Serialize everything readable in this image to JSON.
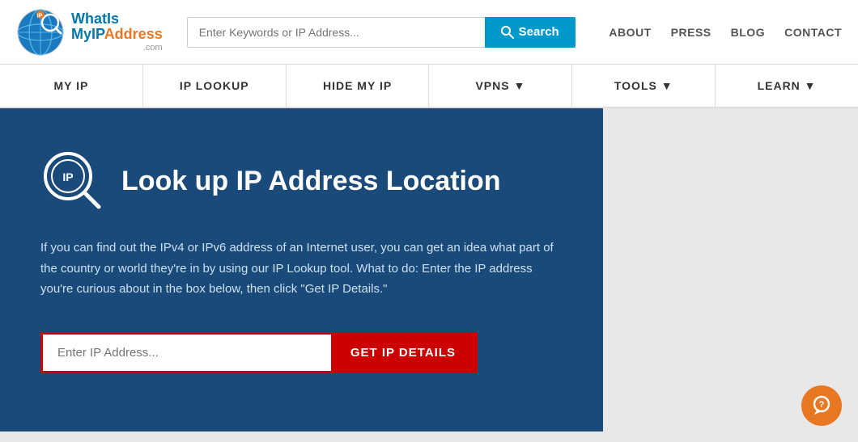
{
  "header": {
    "logo": {
      "whatis": "WhatIs",
      "myip": "MyIP",
      "address": "Address",
      "dotcom": ".com"
    },
    "search": {
      "placeholder": "Enter Keywords or IP Address...",
      "button_label": "Search"
    },
    "nav_links": [
      {
        "label": "ABOUT",
        "id": "about"
      },
      {
        "label": "PRESS",
        "id": "press"
      },
      {
        "label": "BLOG",
        "id": "blog"
      },
      {
        "label": "CONTACT",
        "id": "contact"
      }
    ]
  },
  "navbar": {
    "items": [
      {
        "label": "MY IP",
        "id": "my-ip"
      },
      {
        "label": "IP LOOKUP",
        "id": "ip-lookup"
      },
      {
        "label": "HIDE MY IP",
        "id": "hide-my-ip"
      },
      {
        "label": "VPNS ▼",
        "id": "vpns"
      },
      {
        "label": "TOOLS ▼",
        "id": "tools"
      },
      {
        "label": "LEARN ▼",
        "id": "learn"
      }
    ]
  },
  "main": {
    "title": "Look up IP Address Location",
    "description": "If you can find out the IPv4 or IPv6 address of an Internet user, you can get an idea what part of the country or world they're in by using our IP Lookup tool. What to do: Enter the IP address you're curious about in the box below, then click \"Get IP Details.\"",
    "ip_input_placeholder": "Enter IP Address...",
    "get_details_button": "GET IP DETAILS"
  }
}
